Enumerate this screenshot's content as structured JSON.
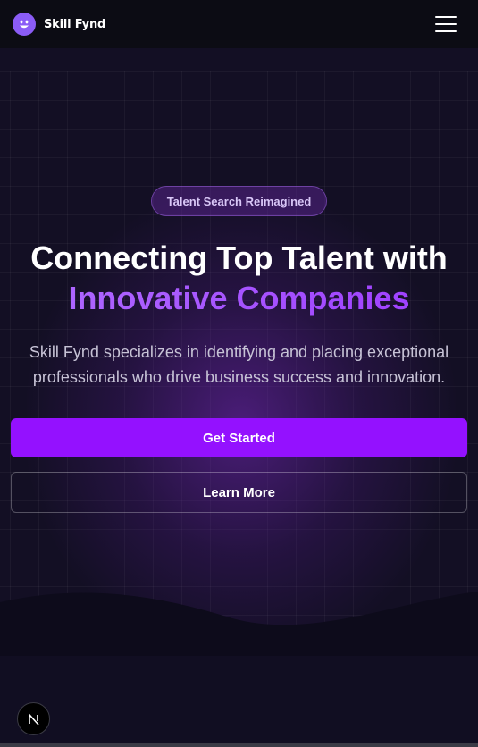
{
  "brand": {
    "name": "Skill Fynd",
    "logo_icon": "smiley-logo-icon",
    "logo_color": "#8b5cf6"
  },
  "nav": {
    "menu_icon": "hamburger-menu-icon"
  },
  "hero": {
    "badge": "Talent Search Reimagined",
    "headline_line1": "Connecting Top Talent with",
    "headline_accent": "Innovative Companies",
    "subtitle": "Skill Fynd specializes in identifying and placing exceptional professionals who drive business success and innovation.",
    "primary_button": "Get Started",
    "secondary_button": "Learn More"
  },
  "colors": {
    "accent": "#9411ff",
    "accent_text": "#a653ff",
    "background": "#130f24",
    "navbar": "#0c0c14"
  },
  "dev_badge": {
    "label": "N",
    "icon": "nextjs-logo-icon"
  }
}
